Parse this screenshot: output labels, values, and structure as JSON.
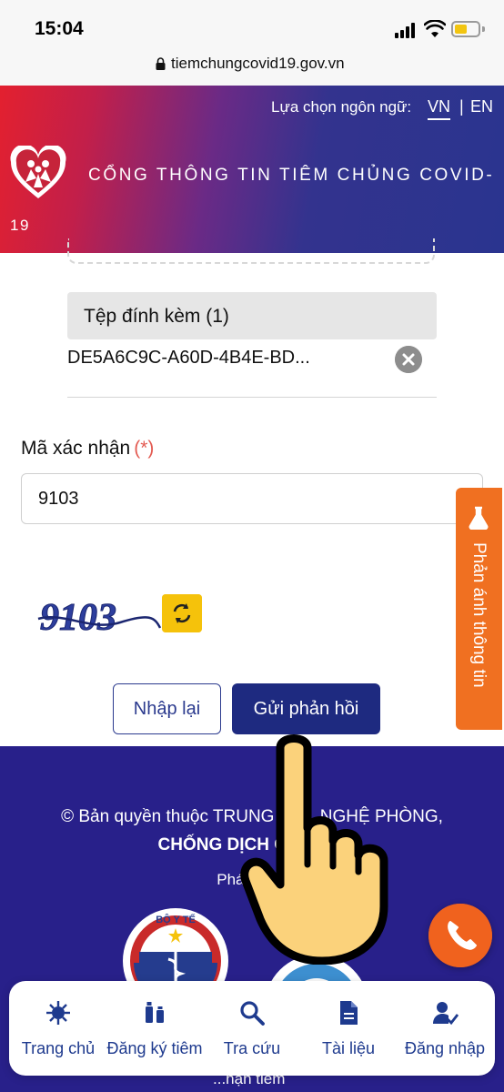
{
  "status_bar": {
    "time": "15:04"
  },
  "browser": {
    "url": "tiemchungcovid19.gov.vn"
  },
  "header": {
    "language_label": "Lựa chọn ngôn ngữ:",
    "lang_vn": "VN",
    "lang_separator": "|",
    "lang_en": "EN",
    "portal_title_line1": "CỔNG THÔNG TIN TIÊM CHỦNG COVID-",
    "portal_title_line2": "19"
  },
  "form": {
    "attachment_title": "Tệp đính kèm (1)",
    "attachment_file": "DE5A6C9C-A60D-4B4E-BD...",
    "captcha_label": "Mã xác nhận",
    "required_mark": "(*)",
    "captcha_value": "9103",
    "captcha_image_text": "9103",
    "reset_label": "Nhập lại",
    "submit_label": "Gửi phản hồi"
  },
  "feedback_tab": {
    "label": "Phản ánh thông tin"
  },
  "footer": {
    "copyright_line1": "© Bản quyền thuộc TRUNG TÂ... NGHỆ PHÒNG,",
    "copyright_line2": "CHỐNG DỊCH CO... ...A",
    "developed_by": "Phát triể...",
    "moh_logo_text": "BỘ Y TẾ",
    "bottom_peek": "...hận tiêm"
  },
  "bottom_nav": {
    "items": [
      {
        "label": "Trang chủ",
        "icon": "virus-icon"
      },
      {
        "label": "Đăng ký tiêm",
        "icon": "vaccine-icon"
      },
      {
        "label": "Tra cứu",
        "icon": "search-icon"
      },
      {
        "label": "Tài liệu",
        "icon": "document-icon"
      },
      {
        "label": "Đăng nhập",
        "icon": "user-check-icon"
      }
    ]
  },
  "colors": {
    "primary": "#1e2a80",
    "footer": "#28208a",
    "accent_orange": "#f07021",
    "captcha_refresh": "#f5c20b",
    "required": "#e35b52",
    "nav_text": "#1e3a8e"
  }
}
